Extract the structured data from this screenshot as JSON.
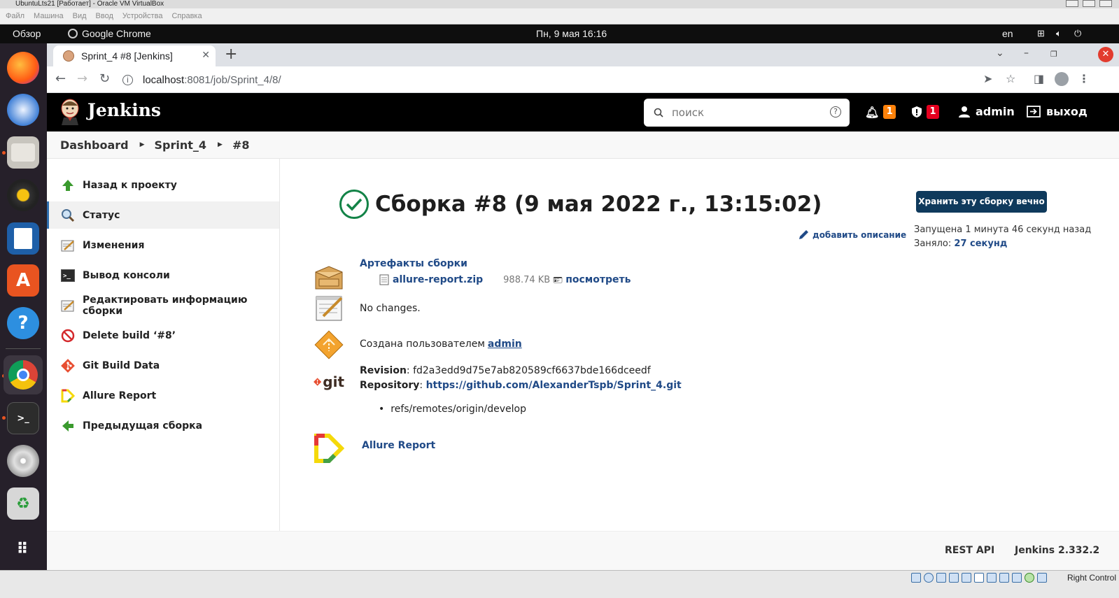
{
  "vbox": {
    "title": "UbuntuLts21 [Работает] - Oracle VM VirtualBox",
    "menu": [
      "Файл",
      "Машина",
      "Вид",
      "Ввод",
      "Устройства",
      "Справка"
    ],
    "status_right": "Right Control"
  },
  "topbar": {
    "overview": "Обзор",
    "app": "Google Chrome",
    "datetime": "Пн, 9 мая  16:16",
    "lang": "en"
  },
  "browser": {
    "tab_title": "Sprint_4 #8 [Jenkins]",
    "url_host": "localhost",
    "url_rest": ":8081/job/Sprint_4/8/"
  },
  "jenkins": {
    "brand": "Jenkins",
    "search_placeholder": "поиск",
    "notifications_count": "1",
    "security_count": "1",
    "user": "admin",
    "logout": "выход",
    "breadcrumb": [
      "Dashboard",
      "Sprint_4",
      "#8"
    ],
    "sidebar": [
      {
        "label": "Назад к проекту",
        "icon": "arrow-up-icon"
      },
      {
        "label": "Статус",
        "icon": "magnifier-icon"
      },
      {
        "label": "Изменения",
        "icon": "notepad-icon"
      },
      {
        "label": "Вывод консоли",
        "icon": "terminal-icon"
      },
      {
        "label": "Редактировать информацию сборки",
        "icon": "notepad-icon"
      },
      {
        "label": "Delete build ‘#8’",
        "icon": "no-entry-icon"
      },
      {
        "label": "Git Build Data",
        "icon": "git-icon"
      },
      {
        "label": "Allure Report",
        "icon": "allure-icon"
      },
      {
        "label": "Предыдущая сборка",
        "icon": "arrow-left-icon"
      }
    ],
    "build_title": "Сборка #8 (9 мая 2022 г., 13:15:02)",
    "keep_button": "Хранить эту сборку вечно",
    "add_description": "добавить описание",
    "started_label": "Запущена 1 минута 46 секунд назад",
    "took_label": "Заняло:",
    "took_value": "27 секунд",
    "artifacts_title": "Артефакты сборки",
    "artifact_name": "allure-report.zip",
    "artifact_size": "988.74 KB",
    "artifact_view": "посмотреть",
    "no_changes": "No changes.",
    "created_by_label": "Создана пользователем",
    "created_by_user": "admin",
    "revision_label": "Revision",
    "revision_value": ": fd2a3edd9d75e7ab820589cf6637bde166dceedf",
    "repository_label": "Repository",
    "repository_value": "https://github.com/AlexanderTspb/Sprint_4.git",
    "branch": "refs/remotes/origin/develop",
    "allure_link": "Allure Report",
    "git_word": "git",
    "footer_api": "REST API",
    "footer_version": "Jenkins 2.332.2"
  },
  "colors": {
    "success": "#138347",
    "link": "#204a87",
    "keep_button": "#0f3a5c",
    "notif_badge": "#fe820a",
    "security_badge": "#e6001f"
  }
}
